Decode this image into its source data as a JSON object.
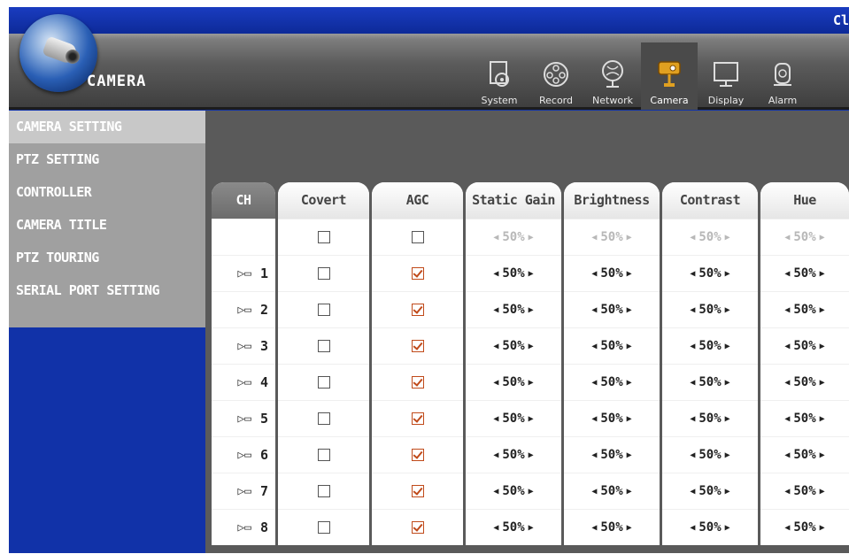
{
  "titlebar": {
    "text": "Cl"
  },
  "app": {
    "brand": "CAMERA"
  },
  "tabs": [
    {
      "label": "System",
      "icon": "system-icon",
      "active": false
    },
    {
      "label": "Record",
      "icon": "record-icon",
      "active": false
    },
    {
      "label": "Network",
      "icon": "network-icon",
      "active": false
    },
    {
      "label": "Camera",
      "icon": "camera-icon",
      "active": true
    },
    {
      "label": "Display",
      "icon": "display-icon",
      "active": false
    },
    {
      "label": "Alarm",
      "icon": "alarm-icon",
      "active": false
    }
  ],
  "menu": [
    {
      "label": "CAMERA SETTING",
      "active": true
    },
    {
      "label": "PTZ SETTING",
      "active": false
    },
    {
      "label": "CONTROLLER",
      "active": false
    },
    {
      "label": "CAMERA TITLE",
      "active": false
    },
    {
      "label": "PTZ TOURING",
      "active": false
    },
    {
      "label": "SERIAL PORT SETTING",
      "active": false
    }
  ],
  "table": {
    "headers": [
      "CH",
      "Covert",
      "AGC",
      "Static Gain",
      "Brightness",
      "Contrast",
      "Hue"
    ],
    "all_row": {
      "covert": false,
      "agc": false,
      "static_gain": "50%",
      "brightness": "50%",
      "contrast": "50%",
      "hue": "50%"
    },
    "rows": [
      {
        "ch": "1",
        "covert": false,
        "agc": true,
        "static_gain": "50%",
        "brightness": "50%",
        "contrast": "50%",
        "hue": "50%"
      },
      {
        "ch": "2",
        "covert": false,
        "agc": true,
        "static_gain": "50%",
        "brightness": "50%",
        "contrast": "50%",
        "hue": "50%"
      },
      {
        "ch": "3",
        "covert": false,
        "agc": true,
        "static_gain": "50%",
        "brightness": "50%",
        "contrast": "50%",
        "hue": "50%"
      },
      {
        "ch": "4",
        "covert": false,
        "agc": true,
        "static_gain": "50%",
        "brightness": "50%",
        "contrast": "50%",
        "hue": "50%"
      },
      {
        "ch": "5",
        "covert": false,
        "agc": true,
        "static_gain": "50%",
        "brightness": "50%",
        "contrast": "50%",
        "hue": "50%"
      },
      {
        "ch": "6",
        "covert": false,
        "agc": true,
        "static_gain": "50%",
        "brightness": "50%",
        "contrast": "50%",
        "hue": "50%"
      },
      {
        "ch": "7",
        "covert": false,
        "agc": true,
        "static_gain": "50%",
        "brightness": "50%",
        "contrast": "50%",
        "hue": "50%"
      },
      {
        "ch": "8",
        "covert": false,
        "agc": true,
        "static_gain": "50%",
        "brightness": "50%",
        "contrast": "50%",
        "hue": "50%"
      }
    ]
  },
  "colors": {
    "background": "#1132a8",
    "panel": "#5a5a5a",
    "menu": "#a0a0a0",
    "check": "#c04a1a"
  }
}
